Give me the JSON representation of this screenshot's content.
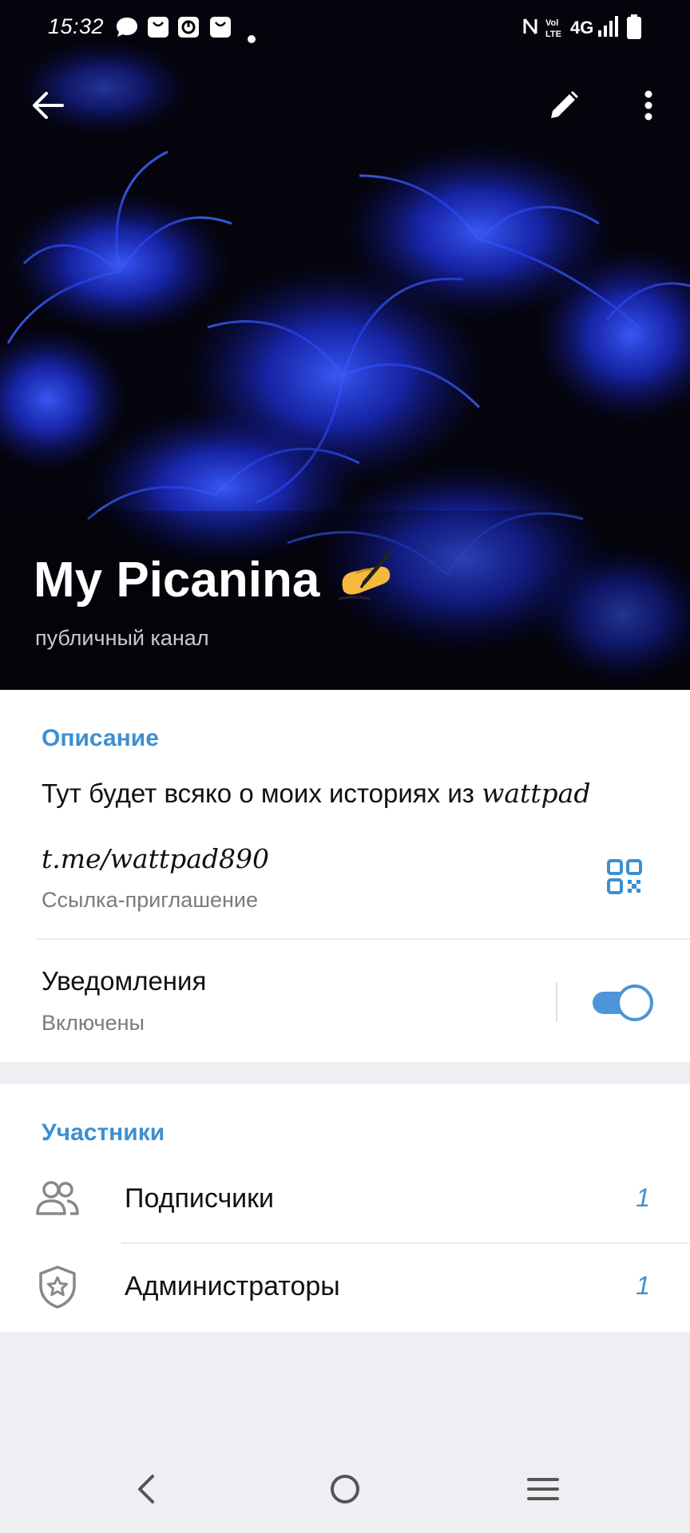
{
  "status_bar": {
    "time": "15:32",
    "notification_icons": [
      "chat-bubble-icon",
      "shopping-bag-icon",
      "pie-app-icon",
      "shopping-bag-icon",
      "dot-icon"
    ],
    "right_icons": [
      "nfc-icon",
      "volte-icon",
      "network-4g-icon",
      "signal-icon",
      "battery-icon"
    ],
    "network": "4G"
  },
  "header": {
    "channel_name": "My Picanina",
    "channel_emoji": "writing-hand-emoji",
    "subtitle": "публичный канал"
  },
  "info": {
    "section_title": "Описание",
    "description_prefix": "Тут будет всяко о моих историях из ",
    "description_styled": "wattpad",
    "invite_link": "t.me/wattpad890",
    "invite_link_caption": "Ссылка-приглашение",
    "notifications_label": "Уведомления",
    "notifications_status": "Включены",
    "notifications_enabled": true
  },
  "members": {
    "section_title": "Участники",
    "rows": [
      {
        "label": "Подписчики",
        "count": "1",
        "icon": "users-icon"
      },
      {
        "label": "Администраторы",
        "count": "1",
        "icon": "shield-star-icon"
      }
    ]
  },
  "colors": {
    "accent": "#3d8fd1",
    "toggle": "#4d95d8",
    "page_background": "#efeff3"
  }
}
